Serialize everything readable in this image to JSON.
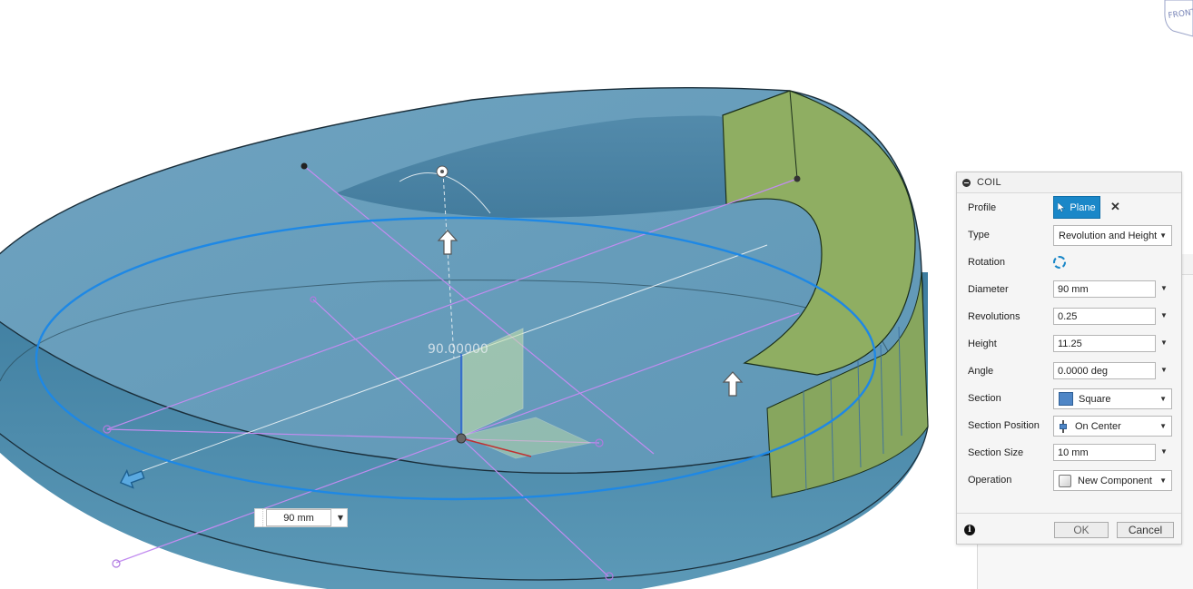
{
  "viewcube": {
    "face_label": "FRONT"
  },
  "canvas": {
    "angle_readout": "90.00000",
    "diameter_input": {
      "value": "90 mm"
    }
  },
  "dialog": {
    "title": "COIL",
    "rows": {
      "profile": {
        "label": "Profile",
        "button": "Plane"
      },
      "type": {
        "label": "Type",
        "value": "Revolution and Height"
      },
      "rotation": {
        "label": "Rotation"
      },
      "diameter": {
        "label": "Diameter",
        "value": "90 mm"
      },
      "revolutions": {
        "label": "Revolutions",
        "value": "0.25"
      },
      "height": {
        "label": "Height",
        "value": "11.25"
      },
      "angle": {
        "label": "Angle",
        "value": "0.0000 deg"
      },
      "section": {
        "label": "Section",
        "value": "Square"
      },
      "section_position": {
        "label": "Section Position",
        "value": "On Center"
      },
      "section_size": {
        "label": "Section Size",
        "value": "10 mm"
      },
      "operation": {
        "label": "Operation",
        "value": "New Component"
      }
    },
    "ok_label": "OK",
    "cancel_label": "Cancel"
  },
  "colors": {
    "body_blue": "#5b94b5",
    "coil_green": "#8fae62",
    "accent": "#1a87c8",
    "sketch_line": "#c28cf0"
  }
}
